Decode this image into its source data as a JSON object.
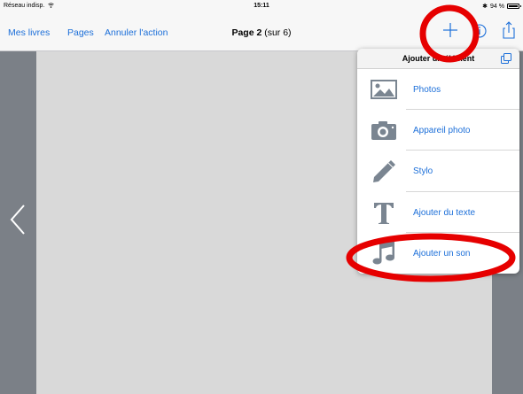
{
  "status_bar": {
    "network": "Réseau indisp.",
    "time": "15:11",
    "battery": "94 %"
  },
  "nav": {
    "my_books": "Mes livres",
    "pages": "Pages",
    "undo": "Annuler l'action",
    "page_label": "Page 2",
    "page_total": "(sur 6)",
    "icons": [
      "plus-icon",
      "info-icon",
      "share-icon"
    ]
  },
  "popover": {
    "title": "Ajouter un élément",
    "items": [
      {
        "label": "Photos",
        "icon": "photos-icon"
      },
      {
        "label": "Appareil photo",
        "icon": "camera-icon"
      },
      {
        "label": "Stylo",
        "icon": "pen-icon"
      },
      {
        "label": "Ajouter du texte",
        "icon": "text-icon"
      },
      {
        "label": "Ajouter un son",
        "icon": "music-note-icon"
      }
    ]
  },
  "colors": {
    "accent": "#1c6fd9",
    "annotation": "#e60000",
    "icon_gray": "#7a8591",
    "background": "#7b8087",
    "page": "#d9d9d9"
  }
}
